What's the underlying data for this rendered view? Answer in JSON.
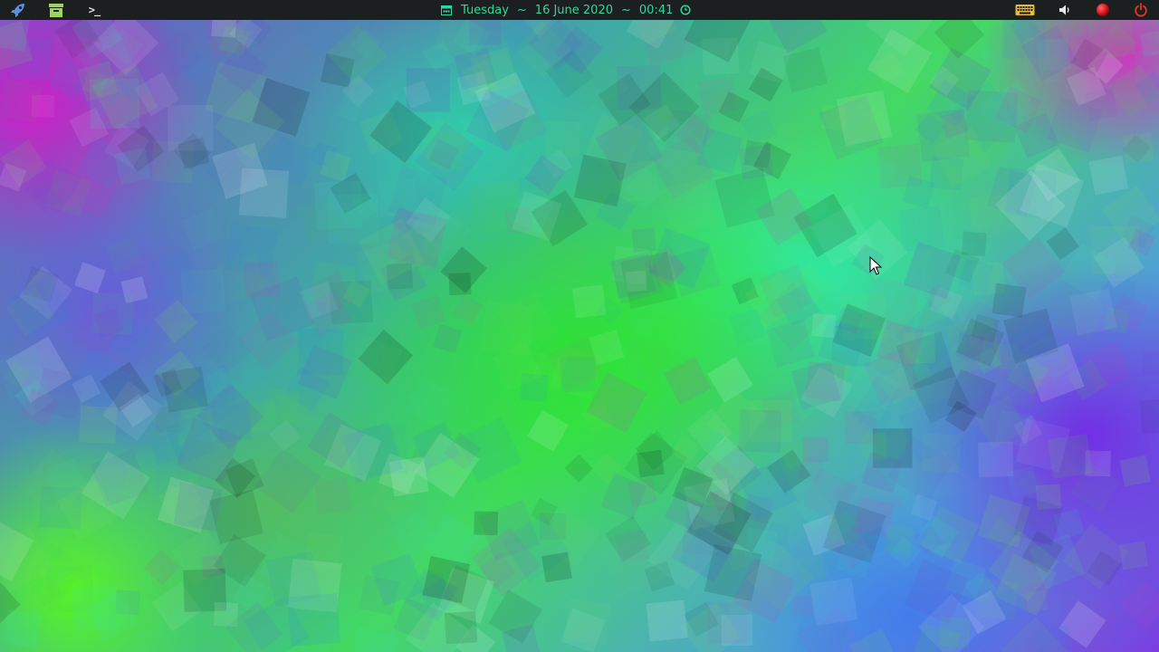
{
  "panel": {
    "launcher_icon": "rocket-icon",
    "files_icon": "archive-box-icon",
    "terminal_icon": "terminal-icon",
    "terminal_glyph": ">_",
    "clock": {
      "calendar_icon": "calendar-icon",
      "day": "Tuesday",
      "separator": "~",
      "date": "16 June 2020",
      "time": "00:41",
      "clock_icon": "clock-icon"
    },
    "keyboard_icon": "keyboard-icon",
    "volume_icon": "volume-icon",
    "record_icon": "record-icon",
    "power_icon": "power-icon"
  },
  "colors": {
    "panel_bg": "#1c1f20",
    "clock_text": "#33d69a",
    "launcher": "#5b8fe0",
    "files": "#9fd45a",
    "keyboard": "#e5b93a",
    "record": "#d9191e",
    "power": "#e8352a"
  },
  "desktop": {
    "wallpaper": "colorful-square-mosaic",
    "pointer_icon": "mouse-pointer-icon"
  }
}
